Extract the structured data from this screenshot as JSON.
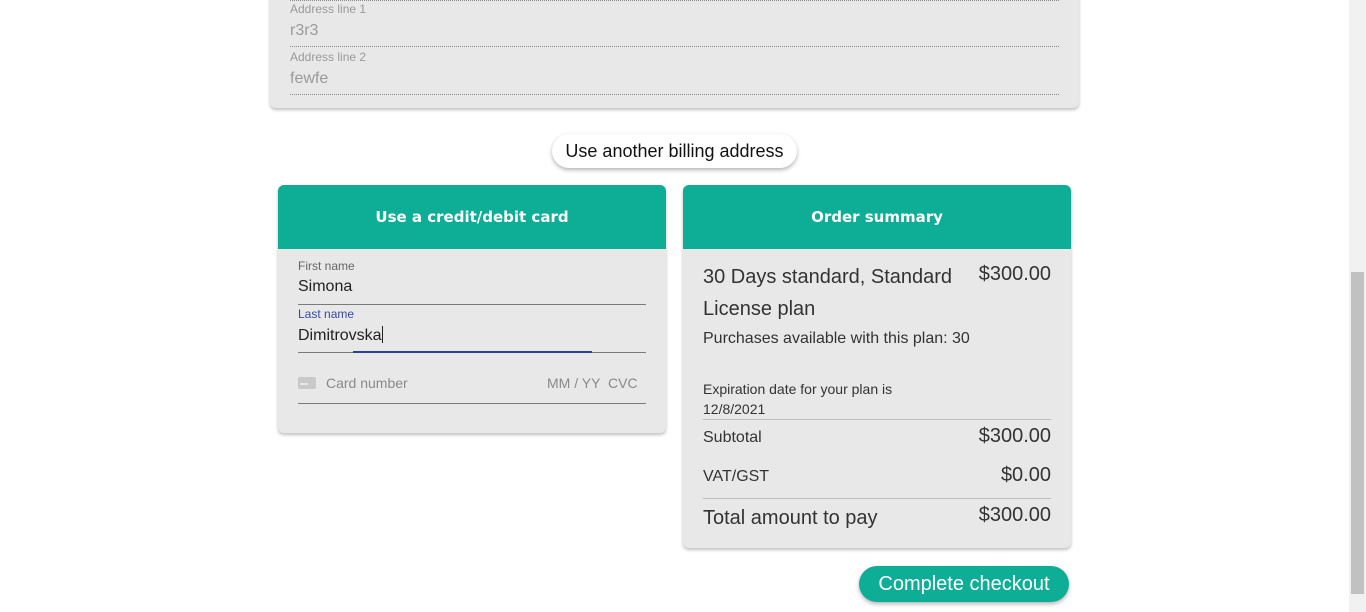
{
  "address": {
    "line1_label": "Address line 1",
    "line1_value": "r3r3",
    "line2_label": "Address line 2",
    "line2_value": "fewfe"
  },
  "billing_button": "Use another billing address",
  "card_form": {
    "header": "Use a credit/debit card",
    "first_name_label": "First name",
    "first_name_value": "Simona",
    "last_name_label": "Last name",
    "last_name_value": "Dimitrovska",
    "card_number_placeholder": "Card number",
    "expiry_placeholder": "MM / YY",
    "cvc_placeholder": "CVC"
  },
  "order_summary": {
    "header": "Order summary",
    "plan_name": "30 Days standard, Standard License plan",
    "plan_price": "$300.00",
    "purchases_text": "Purchases available with this plan: 30",
    "expiration_text": "Expiration date for your plan is 12/8/2021",
    "subtotal_label": "Subtotal",
    "subtotal_value": "$300.00",
    "vat_label": "VAT/GST",
    "vat_value": "$0.00",
    "total_label": "Total amount to pay",
    "total_value": "$300.00"
  },
  "checkout_button": "Complete checkout",
  "colors": {
    "accent": "#0eae96",
    "card_background": "#e8e8e8",
    "focus_underline": "#2f3f9a"
  }
}
